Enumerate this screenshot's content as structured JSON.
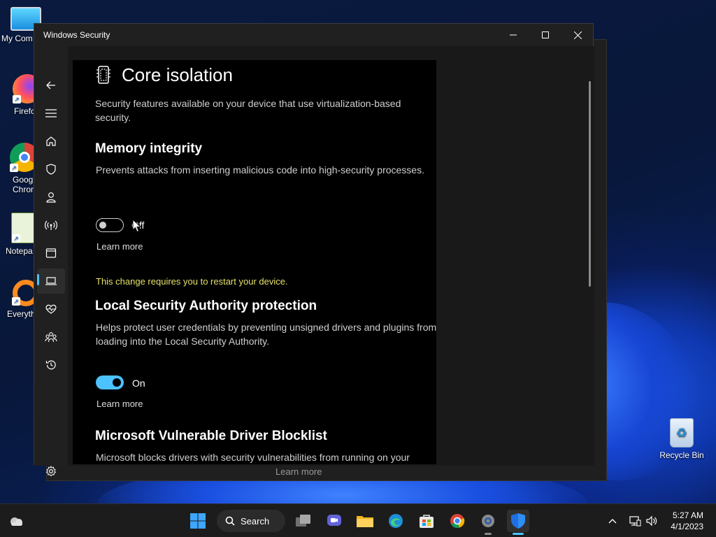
{
  "desktop": {
    "icons": [
      {
        "label": "My Com"
      },
      {
        "label": "Firefo"
      },
      {
        "label": "Goog Chrom"
      },
      {
        "label": "Notepa"
      },
      {
        "label": "Everyth"
      },
      {
        "label": "Recycle Bin"
      }
    ]
  },
  "ghost": {
    "learn_more": "Learn more"
  },
  "window": {
    "title": "Windows Security",
    "page_title": "Core isolation",
    "intro": "Security features available on your device that use virtualization-based security.",
    "memory_integrity": {
      "heading": "Memory integrity",
      "description": "Prevents attacks from inserting malicious code into high-security processes.",
      "toggle_label": "Off",
      "learn_more": "Learn more",
      "restart_warning": "This change requires you to restart your device."
    },
    "lsa": {
      "heading": "Local Security Authority protection",
      "description": "Helps protect user credentials by preventing unsigned drivers and plugins from loading into the Local Security Authority.",
      "toggle_label": "On",
      "learn_more": "Learn more"
    },
    "blocklist": {
      "heading": "Microsoft Vulnerable Driver Blocklist",
      "description": "Microsoft blocks drivers with security vulnerabilities from running on your"
    }
  },
  "taskbar": {
    "search_label": "Search",
    "time": "5:27 AM",
    "date": "4/1/2023"
  },
  "colors": {
    "accent": "#4cc2ff",
    "warning": "#e6e06a",
    "content_bg": "#000000",
    "window_bg": "#202020"
  }
}
